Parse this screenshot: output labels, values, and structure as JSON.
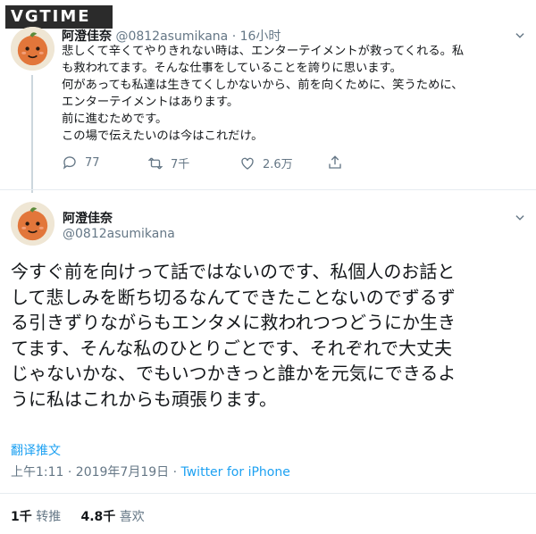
{
  "watermark": "VGTIME",
  "reply_tweet": {
    "author_name": "阿澄佳奈",
    "author_handle": "@0812asumikana",
    "separator": " · ",
    "time": "16小时",
    "lines": [
      "悲しくて辛くてやりきれない時は、エンターテイメントが救ってくれる。私",
      "も救われてます。そんな仕事をしていることを誇りに思います。",
      "何があっても私達は生きてくしかないから、前を向くために、笑うために、",
      "エンターテイメントはあります。",
      "前に進むためです。",
      "この場で伝えたいのは今はこれだけ。"
    ],
    "reply_count": "77",
    "retweet_count": "7千",
    "like_count": "2.6万"
  },
  "main_tweet": {
    "author_name": "阿澄佳奈",
    "author_handle": "@0812asumikana",
    "lines": [
      "今すぐ前を向けって話ではないのです、私個人のお話と",
      "して悲しみを断ち切るなんてできたことないのでずるず",
      "る引きずりながらもエンタメに救われつつどうにか生き",
      "てます、そんな私のひとりごとです、それぞれで大丈夫",
      "じゃないかな、でもいつかきっと誰かを元気にできるよ",
      "うに私はこれからも頑張ります。"
    ],
    "translate_label": "翻译推文",
    "timestamp": "上午1:11 · 2019年7月19日 · ",
    "source": "Twitter for iPhone",
    "retweets_count": "1千",
    "retweets_label": "转推",
    "likes_count": "4.8千",
    "likes_label": "喜欢"
  },
  "colors": {
    "accent": "#1da1f2",
    "secondary_text": "#657786",
    "divider": "#e6ecf0"
  }
}
